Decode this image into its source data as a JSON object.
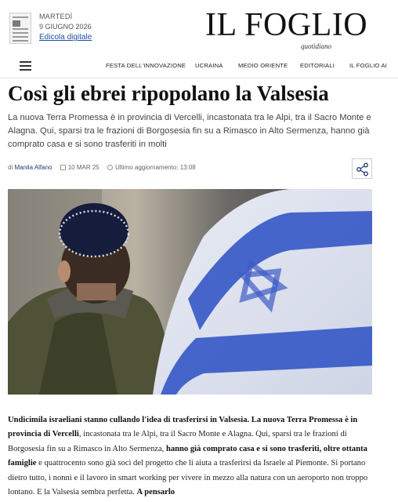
{
  "header": {
    "day": "MARTEDÌ",
    "date": "9 GIUGNO 2026",
    "edicola_link": "Edicola digitale",
    "logo": "IL FOGLIO",
    "logo_sub": "quotidiano"
  },
  "nav": {
    "items": [
      {
        "label": "FESTA DELL'INNOVAZIONE"
      },
      {
        "label": "UCRAINA"
      },
      {
        "label": "MEDIO ORIENTE"
      },
      {
        "label": "EDITORIALI"
      },
      {
        "label": "IL FOGLIO AI"
      }
    ]
  },
  "article": {
    "title": "Così gli ebrei ripopolano la Valsesia",
    "subtitle": "La nuova Terra Promessa è in provincia di Vercelli, incastonata tra le Alpi, tra il Sacro Monte e Alagna. Qui, sparsi tra le frazioni di Borgosesia fin su a Rimasco in Alto Sermenza, hanno già comprato casa e si sono trasferiti in molti",
    "byline_prefix": "di",
    "author": "Manila Alfano",
    "published": "10 MAR 25",
    "updated_label": "Ultimo aggiornamento:",
    "updated_time": "13:08",
    "body": {
      "s1": "Undicimila israeliani stanno cullando l'idea di trasferirsi in Valsesia. La nuova Terra Promessa è in provincia di Vercelli",
      "s2": ", incastonata tra le Alpi, tra il Sacro Monte e Alagna. Qui, sparsi tra le frazioni di Borgosesia fin su a Rimasco in Alto Sermenza, ",
      "s3": "hanno già comprato casa e si sono trasferiti, oltre ottanta famiglie",
      "s4": " e quattrocento sono già soci del progetto che li aiuta a trasferirsi da Israele al Piemonte. Si portano dietro tutto, i nonni e il lavoro in smart working per vivere in mezzo alla natura con un aeroporto non troppo lontano. E la Valsesia sembra perfetta. ",
      "s5": "A pensarlo"
    }
  },
  "icons": {
    "menu": "hamburger-icon",
    "share": "share-icon",
    "calendar": "calendar-icon",
    "clock": "clock-icon"
  },
  "colors": {
    "link": "#1f4fa0",
    "author": "#1f3c78",
    "flag_blue": "#2a4fc4"
  }
}
